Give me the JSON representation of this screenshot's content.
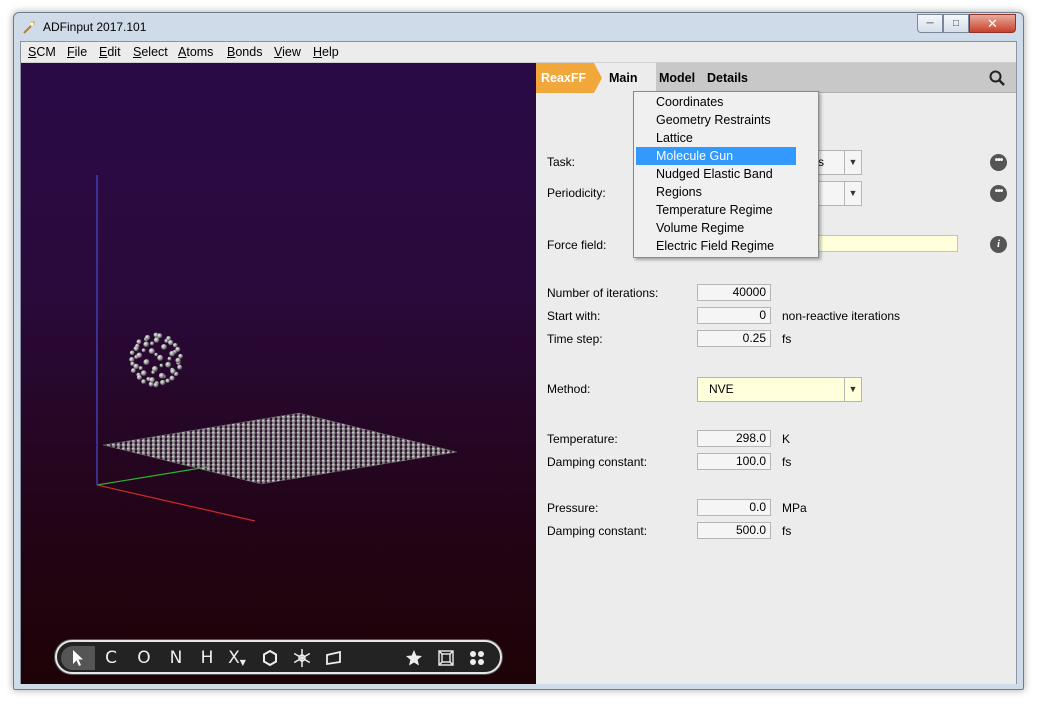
{
  "window": {
    "title": "ADFinput 2017.101"
  },
  "menubar": [
    {
      "accel": "S",
      "rest": "CM"
    },
    {
      "accel": "F",
      "rest": "ile"
    },
    {
      "accel": "E",
      "rest": "dit"
    },
    {
      "accel": "S",
      "rest": "elect"
    },
    {
      "accel": "A",
      "rest": "toms"
    },
    {
      "accel": "B",
      "rest": "onds"
    },
    {
      "accel": "V",
      "rest": "iew"
    },
    {
      "accel": "H",
      "rest": "elp"
    }
  ],
  "panel_nav": {
    "engine": "ReaxFF",
    "page": "Main",
    "menus": [
      "Model",
      "Details"
    ]
  },
  "dropdown": {
    "items": [
      "Coordinates",
      "Geometry Restraints",
      "Lattice",
      "Molecule Gun",
      "Nudged Elastic Band",
      "Regions",
      "Temperature Regime",
      "Volume Regime",
      "Electric Field Regime"
    ],
    "active_index": 3
  },
  "form": {
    "task_label": "Task:",
    "task_value_tail": "s",
    "periodicity_label": "Periodicity:",
    "force_field_label": "Force field:",
    "iterations_label": "Number of iterations:",
    "iterations_value": "40000",
    "start_with_label": "Start with:",
    "start_with_value": "0",
    "start_with_unit": "non-reactive iterations",
    "time_step_label": "Time step:",
    "time_step_value": "0.25",
    "time_step_unit": "fs",
    "method_label": "Method:",
    "method_value": "NVE",
    "temperature_label": "Temperature:",
    "temperature_value": "298.0",
    "temperature_unit": "K",
    "damping1_label": "Damping constant:",
    "damping1_value": "100.0",
    "damping1_unit": "fs",
    "pressure_label": "Pressure:",
    "pressure_value": "0.0",
    "pressure_unit": "MPa",
    "damping2_label": "Damping constant:",
    "damping2_value": "500.0",
    "damping2_unit": "fs"
  },
  "toolbar": {
    "tools": [
      "C",
      "O",
      "N",
      "H",
      "X"
    ]
  },
  "colors": {
    "reaxff_crumb": "#f2a73b",
    "dropdown_highlight": "#3399ff",
    "yellow_field": "#ffffdc"
  }
}
